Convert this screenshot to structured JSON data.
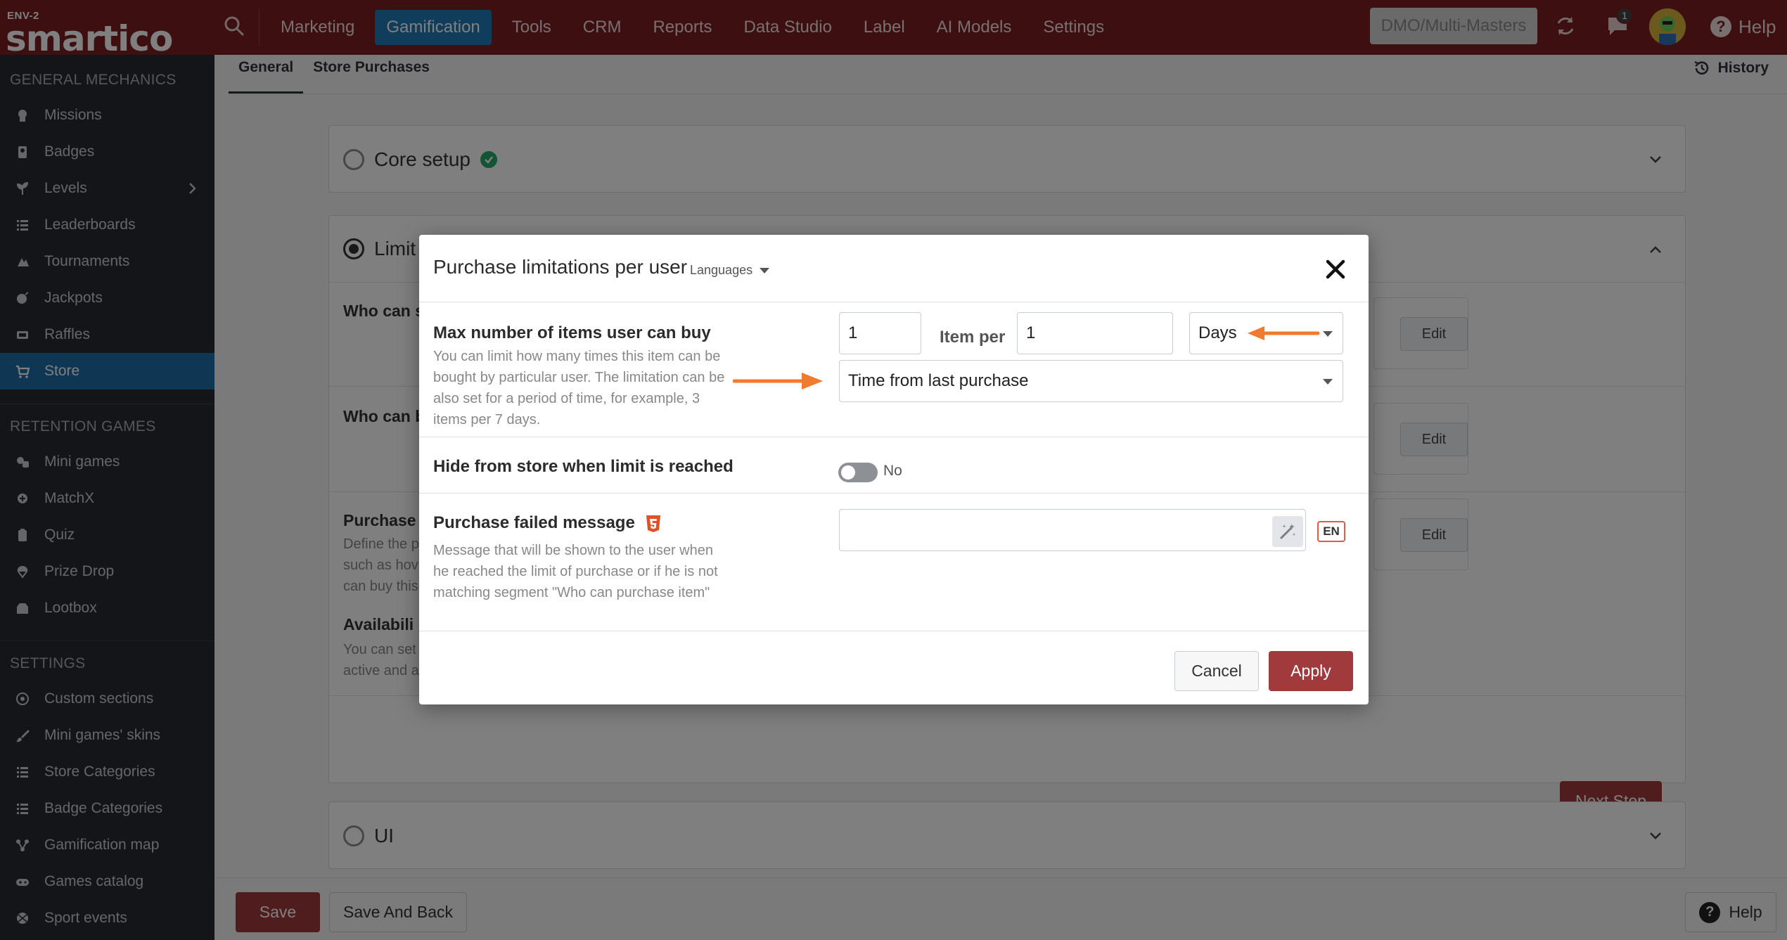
{
  "topbar": {
    "env": "ENV-2",
    "brand": "smartico",
    "nav": [
      "Marketing",
      "Gamification",
      "Tools",
      "CRM",
      "Reports",
      "Data Studio",
      "Label",
      "AI Models",
      "Settings"
    ],
    "active_nav": "Gamification",
    "tenant": "DMO/Multi-Masters",
    "chat_badge": "1",
    "help": "Help",
    "accent": "#7b1f22",
    "active_color": "#1f7bb6"
  },
  "sidebar": {
    "sections": [
      {
        "title": "GENERAL MECHANICS",
        "items": [
          {
            "label": "Missions",
            "icon": "mission-icon"
          },
          {
            "label": "Badges",
            "icon": "badge-icon"
          },
          {
            "label": "Levels",
            "icon": "levels-icon",
            "has_children": true
          },
          {
            "label": "Leaderboards",
            "icon": "list-icon"
          },
          {
            "label": "Tournaments",
            "icon": "tournament-icon"
          },
          {
            "label": "Jackpots",
            "icon": "jackpot-icon"
          },
          {
            "label": "Raffles",
            "icon": "raffle-icon"
          },
          {
            "label": "Store",
            "icon": "cart-icon",
            "active": true
          }
        ]
      },
      {
        "title": "RETENTION GAMES",
        "items": [
          {
            "label": "Mini games",
            "icon": "minigames-icon"
          },
          {
            "label": "MatchX",
            "icon": "matchx-icon"
          },
          {
            "label": "Quiz",
            "icon": "quiz-icon"
          },
          {
            "label": "Prize Drop",
            "icon": "prize-drop-icon"
          },
          {
            "label": "Lootbox",
            "icon": "lootbox-icon"
          }
        ]
      },
      {
        "title": "SETTINGS",
        "items": [
          {
            "label": "Custom sections",
            "icon": "custom-sections-icon"
          },
          {
            "label": "Mini games' skins",
            "icon": "brush-icon"
          },
          {
            "label": "Store Categories",
            "icon": "list-icon"
          },
          {
            "label": "Badge Categories",
            "icon": "list-icon"
          },
          {
            "label": "Gamification map",
            "icon": "map-icon"
          },
          {
            "label": "Games catalog",
            "icon": "gamepad-icon"
          },
          {
            "label": "Sport events",
            "icon": "sport-icon"
          }
        ]
      }
    ]
  },
  "main": {
    "tabs": [
      "General",
      "Store Purchases"
    ],
    "history": "History",
    "panels": {
      "core_setup": "Core setup",
      "limitations_prefix": "Limit",
      "ui": "UI"
    },
    "rows": {
      "who_can_1": "Who can s",
      "who_can_2": "Who can b",
      "purchase_label": "Purchase",
      "purchase_desc_lines": [
        "Define the p",
        "such as hov",
        "can buy this"
      ],
      "availability_label": "Availabili",
      "availability_desc_lines": [
        "You can set",
        "active and a"
      ]
    },
    "edit_label": "Edit",
    "next_step": "Next Step",
    "bottom": {
      "save": "Save",
      "save_and_back": "Save And Back",
      "help": "Help"
    }
  },
  "modal": {
    "title": "Purchase limitations per user",
    "languages": "Languages",
    "max_items": {
      "label": "Max number of items user can buy",
      "desc": "You can limit how many times this item can be bought by particular user. The limitation can be also set for a period of time, for example, 3 items per 7 days.",
      "qty_value": "1",
      "item_per_label": "Item per",
      "period_value": "1",
      "period_unit": "Days",
      "period_type": "Time from last purchase"
    },
    "hide_when_limit": {
      "label": "Hide from store when limit is reached",
      "toggle_text": "No",
      "enabled": false
    },
    "failed_message": {
      "label": "Purchase failed message",
      "desc": "Message that will be shown to the user when he reached the limit of purchase or if he is not matching segment \"Who can purchase item\"",
      "value": "",
      "lang_badge": "EN"
    },
    "cancel": "Cancel",
    "apply": "Apply",
    "annotation_color": "#f07a2e"
  }
}
